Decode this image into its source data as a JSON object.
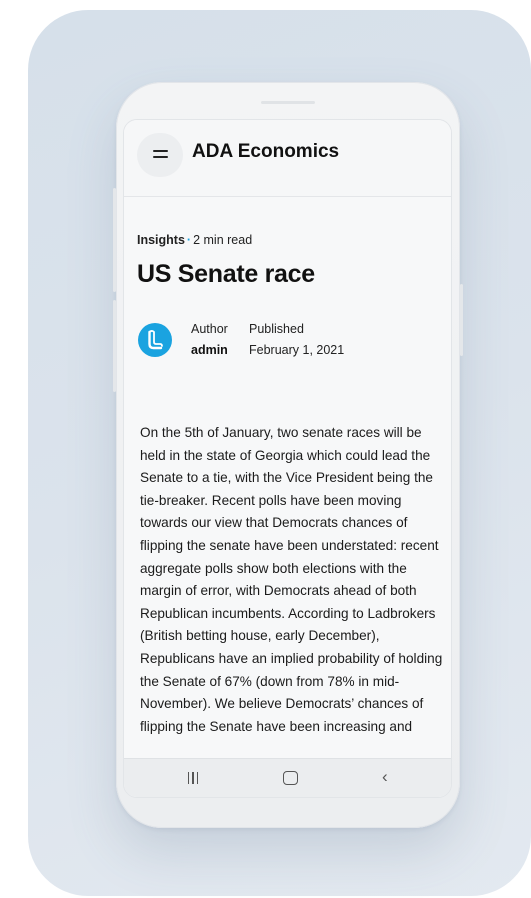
{
  "app": {
    "title": "ADA Economics"
  },
  "post": {
    "category": "Insights",
    "separator": "·",
    "read_time": "2 min read",
    "title": "US Senate race",
    "author_label": "Author",
    "author_name": "admin",
    "published_label": "Published",
    "published_date": "February 1, 2021",
    "body": "On the 5th of January, two senate races will be held in the state of Georgia which could lead the Senate to a tie, with the Vice President being the tie-breaker. Recent polls have been moving towards our view that Democrats chances of flipping the senate have been understated: recent aggregate polls show both elections with the margin of error, with Democrats ahead of both Republican incumbents.  According to Ladbrokers (British betting house, early December), Republicans have an implied probability of holding the Senate of 67% (down from 78% in mid-November). We believe Democrats’ chances of flipping the Senate have been increasing and"
  },
  "icons": {
    "menu": "hamburger-menu-icon",
    "avatar": "author-logo-icon",
    "nav_recents": "recents-icon",
    "nav_home": "home-icon",
    "nav_back": "back-icon"
  },
  "colors": {
    "accent": "#1aa3e0",
    "backdrop": "#dae2eb",
    "screen_bg": "#f7f8f9"
  }
}
